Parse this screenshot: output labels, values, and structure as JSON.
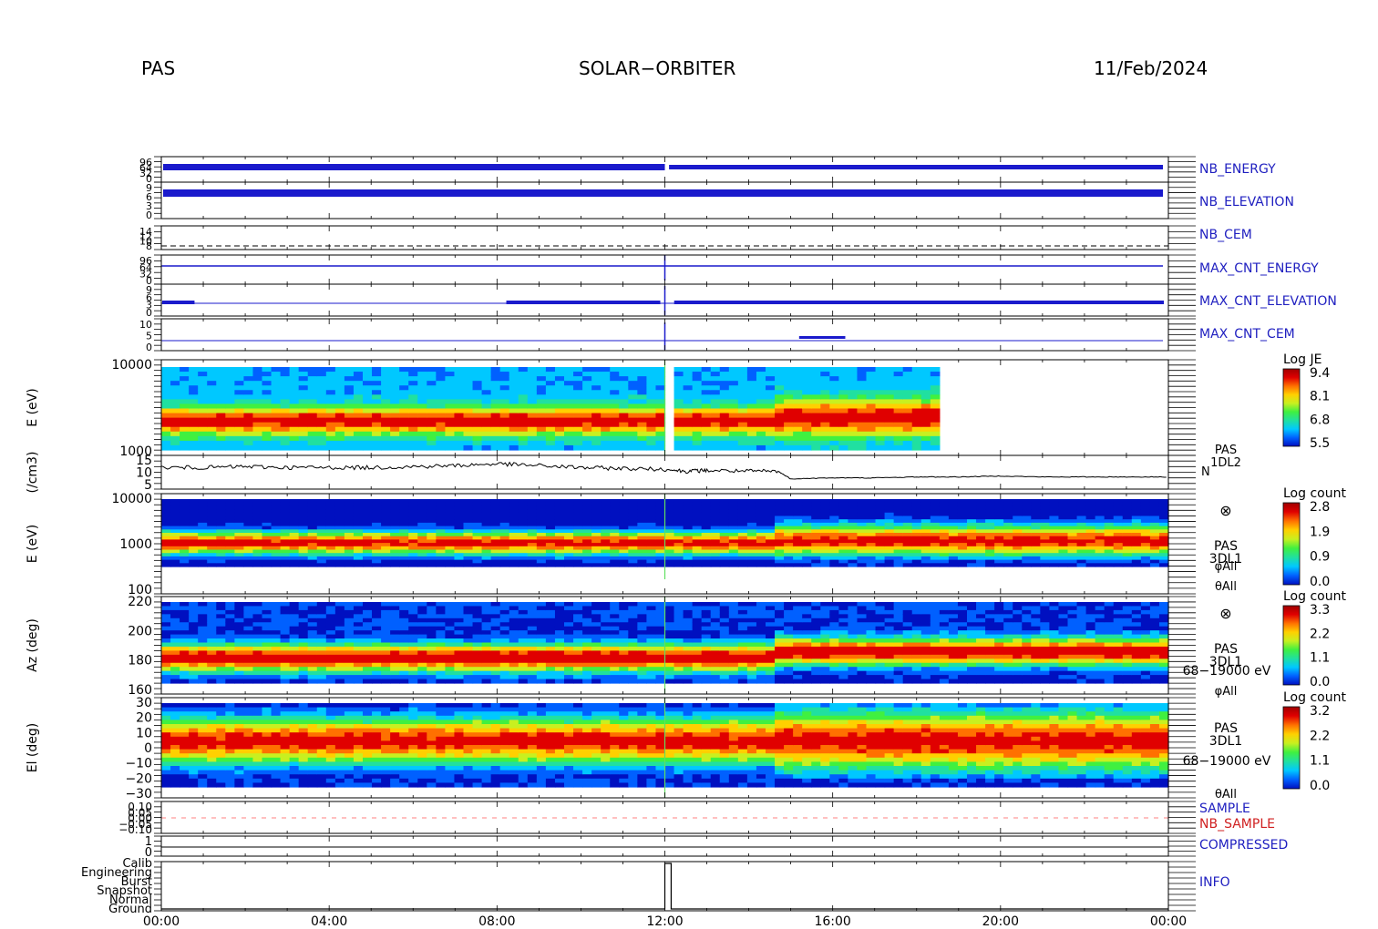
{
  "header": {
    "instrument": "PAS",
    "mission": "SOLAR−ORBITER",
    "date": "11/Feb/2024"
  },
  "colors": {
    "blue_label": "#2020c0",
    "red_label": "#d02020",
    "trace_blue": "#1a1acc",
    "trace_black": "#000000",
    "sample_red": "#ff8080"
  },
  "colorscale_stops": [
    "#0010c0",
    "#0060ff",
    "#00c8ff",
    "#20e0a0",
    "#40f040",
    "#c8f020",
    "#ffd000",
    "#ff7000",
    "#e00000",
    "#a00000"
  ],
  "x_axis": {
    "ticks": [
      "00:00",
      "04:00",
      "08:00",
      "12:00",
      "16:00",
      "20:00",
      "00:00"
    ],
    "range_hours": [
      0,
      24
    ]
  },
  "chart_data": [
    {
      "type": "line",
      "id": "nb_energy",
      "right_label": "NB_ENERGY",
      "ytick_labels": [
        "96",
        "64",
        "32",
        "0"
      ],
      "series_level": [
        0.55,
        0.6
      ],
      "note": "gap after 12:00"
    },
    {
      "type": "line",
      "id": "nb_elevation",
      "right_label": "NB_ELEVATION",
      "ytick_labels": [
        "9",
        "6",
        "3",
        "0"
      ]
    },
    {
      "type": "line",
      "id": "nb_cem",
      "right_label": "NB_CEM",
      "ytick_labels": [
        "14",
        "12",
        "10",
        "8"
      ],
      "constant_value": 9
    },
    {
      "type": "line",
      "id": "max_cnt_energy",
      "right_label": "MAX_CNT_ENERGY",
      "ytick_labels": [
        "96",
        "64",
        "32",
        "0"
      ]
    },
    {
      "type": "line",
      "id": "max_cnt_elevation",
      "right_label": "MAX_CNT_ELEVATION",
      "ytick_labels": [
        "9",
        "6",
        "3",
        "0"
      ]
    },
    {
      "type": "line",
      "id": "max_cnt_cem",
      "right_label": "MAX_CNT_CEM",
      "ytick_labels": [
        "10",
        "5",
        "0"
      ]
    },
    {
      "type": "heatmap",
      "id": "je_spectrogram",
      "ylabel": "E (eV)",
      "ytick_labels": [
        "10000",
        "1000"
      ],
      "yscale": "log",
      "colorbar_title": "Log JE",
      "colorbar_ticks": [
        "9.4",
        "8.1",
        "6.8",
        "5.5"
      ],
      "data_end_hours": 18.4
    },
    {
      "type": "line",
      "id": "density",
      "ylabel": "(/cm3)",
      "ytick_labels": [
        "15",
        "10",
        "5"
      ],
      "right_label_1": "PAS",
      "right_label_2": "1DL2",
      "right_label_3": "N",
      "x_hours": [
        0,
        1,
        2,
        3,
        4,
        5,
        6,
        7,
        8,
        9,
        10,
        11,
        12,
        12.5,
        13,
        14,
        14.7,
        15,
        16,
        17,
        18,
        19,
        20,
        21,
        22,
        23,
        24
      ],
      "values": [
        12,
        12,
        12.5,
        12,
        12,
        12,
        12.5,
        13,
        14,
        13,
        12,
        11.5,
        11,
        10,
        10.5,
        10,
        10,
        6,
        6.5,
        6.5,
        7,
        7,
        7.5,
        7,
        7,
        7,
        7
      ]
    },
    {
      "type": "heatmap",
      "id": "count_energy",
      "ylabel": "E (eV)",
      "ytick_labels": [
        "10000",
        "1000",
        "100"
      ],
      "yscale": "log",
      "colorbar_title": "Log count",
      "colorbar_ticks": [
        "2.8",
        "1.9",
        "0.9",
        "0.0"
      ],
      "right_label_1": "PAS",
      "right_label_2": "3DL1",
      "right_label_3": "φAll",
      "right_label_4": "θAll"
    },
    {
      "type": "heatmap",
      "id": "count_azimuth",
      "ylabel": "Az (deg)",
      "ytick_labels": [
        "220",
        "200",
        "180",
        "160"
      ],
      "colorbar_title": "Log count",
      "colorbar_ticks": [
        "3.3",
        "2.2",
        "1.1",
        "0.0"
      ],
      "right_label_1": "PAS",
      "right_label_2": "3DL1",
      "right_label_3": "68−19000 eV",
      "right_label_4": "φAll"
    },
    {
      "type": "heatmap",
      "id": "count_elevation",
      "ylabel": "El (deg)",
      "ytick_labels": [
        "30",
        "20",
        "10",
        "0",
        "−10",
        "−20",
        "−30"
      ],
      "colorbar_title": "Log count",
      "colorbar_ticks": [
        "3.2",
        "2.2",
        "1.1",
        "0.0"
      ],
      "right_label_1": "PAS",
      "right_label_2": "3DL1",
      "right_label_3": "68−19000 eV",
      "right_label_4": "θAll"
    },
    {
      "type": "line",
      "id": "sample",
      "right_label_1": "SAMPLE",
      "right_label_2": "NB_SAMPLE",
      "ytick_labels": [
        "0.10",
        "0.05",
        "0.00",
        "−0.05",
        "−0.10"
      ]
    },
    {
      "type": "line",
      "id": "compressed",
      "right_label": "COMPRESSED",
      "ytick_labels": [
        "1",
        "0"
      ]
    },
    {
      "type": "line",
      "id": "info",
      "right_label": "INFO",
      "ytick_labels": [
        "Calib",
        "Engineering",
        "Burst",
        "Snapshot",
        "Normal",
        "Ground"
      ],
      "step_x_hours": [
        0,
        12.0,
        12.0,
        12.15,
        12.15,
        24
      ],
      "step_levels": [
        "Ground",
        "Ground",
        "Calib",
        "Calib",
        "Ground",
        "Ground"
      ]
    }
  ]
}
